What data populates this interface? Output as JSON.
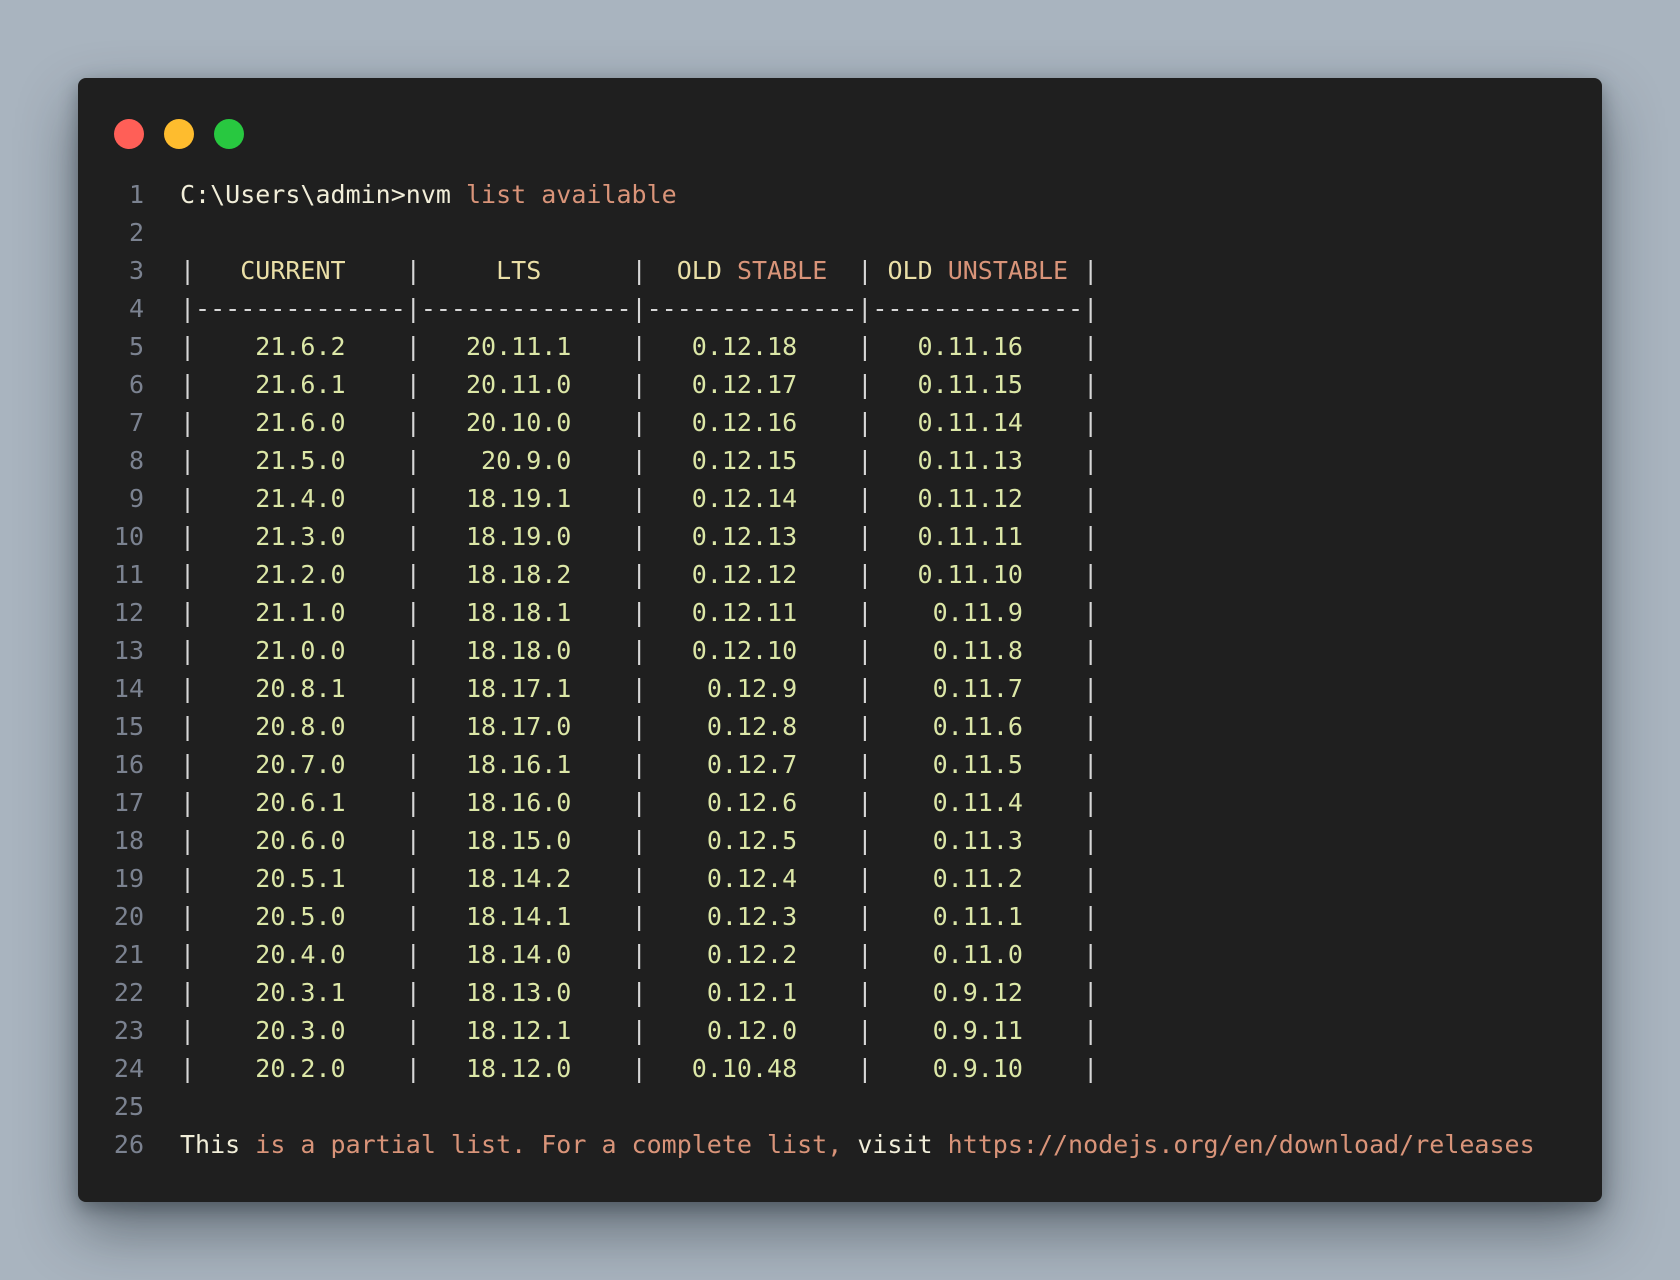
{
  "window": {
    "dots": [
      {
        "name": "close-dot",
        "color": "#ff5f57"
      },
      {
        "name": "minimize-dot",
        "color": "#febc2e"
      },
      {
        "name": "maximize-dot",
        "color": "#28c840"
      }
    ]
  },
  "colors": {
    "background": "#a9b4bf",
    "panel": "#1f1f1f",
    "line_number": "#7b8290",
    "plain_text": "#f1eed9",
    "string_text": "#d99479",
    "header_text": "#eadfa7",
    "version_text": "#dce7a7",
    "bar_text": "#d7d7d7"
  },
  "lines": [
    {
      "number": "1",
      "segments": [
        {
          "text": "C:\\Users\\admin>nvm ",
          "kind": "plain"
        },
        {
          "text": "list available",
          "kind": "str"
        }
      ]
    },
    {
      "number": "2",
      "segments": []
    },
    {
      "number": "3",
      "segments": [
        {
          "text": "|",
          "kind": "bar"
        },
        {
          "text": "   CURRENT    ",
          "kind": "head"
        },
        {
          "text": "|",
          "kind": "bar"
        },
        {
          "text": "     LTS      ",
          "kind": "head"
        },
        {
          "text": "|",
          "kind": "bar"
        },
        {
          "text": "  OLD ",
          "kind": "head"
        },
        {
          "text": "STABLE",
          "kind": "str"
        },
        {
          "text": "  ",
          "kind": "head"
        },
        {
          "text": "|",
          "kind": "bar"
        },
        {
          "text": " OLD ",
          "kind": "head"
        },
        {
          "text": "UNSTABLE",
          "kind": "str"
        },
        {
          "text": " ",
          "kind": "head"
        },
        {
          "text": "|",
          "kind": "bar"
        }
      ]
    },
    {
      "number": "4",
      "segments": [
        {
          "text": "|--------------|--------------|--------------|--------------|",
          "kind": "bar"
        }
      ]
    },
    {
      "number": "5",
      "segments": [
        {
          "text": "|",
          "kind": "bar"
        },
        {
          "text": "    21.6.2    ",
          "kind": "num"
        },
        {
          "text": "|",
          "kind": "bar"
        },
        {
          "text": "   20.11.1    ",
          "kind": "num"
        },
        {
          "text": "|",
          "kind": "bar"
        },
        {
          "text": "   0.12.18    ",
          "kind": "num"
        },
        {
          "text": "|",
          "kind": "bar"
        },
        {
          "text": "   0.11.16    ",
          "kind": "num"
        },
        {
          "text": "|",
          "kind": "bar"
        }
      ]
    },
    {
      "number": "6",
      "segments": [
        {
          "text": "|",
          "kind": "bar"
        },
        {
          "text": "    21.6.1    ",
          "kind": "num"
        },
        {
          "text": "|",
          "kind": "bar"
        },
        {
          "text": "   20.11.0    ",
          "kind": "num"
        },
        {
          "text": "|",
          "kind": "bar"
        },
        {
          "text": "   0.12.17    ",
          "kind": "num"
        },
        {
          "text": "|",
          "kind": "bar"
        },
        {
          "text": "   0.11.15    ",
          "kind": "num"
        },
        {
          "text": "|",
          "kind": "bar"
        }
      ]
    },
    {
      "number": "7",
      "segments": [
        {
          "text": "|",
          "kind": "bar"
        },
        {
          "text": "    21.6.0    ",
          "kind": "num"
        },
        {
          "text": "|",
          "kind": "bar"
        },
        {
          "text": "   20.10.0    ",
          "kind": "num"
        },
        {
          "text": "|",
          "kind": "bar"
        },
        {
          "text": "   0.12.16    ",
          "kind": "num"
        },
        {
          "text": "|",
          "kind": "bar"
        },
        {
          "text": "   0.11.14    ",
          "kind": "num"
        },
        {
          "text": "|",
          "kind": "bar"
        }
      ]
    },
    {
      "number": "8",
      "segments": [
        {
          "text": "|",
          "kind": "bar"
        },
        {
          "text": "    21.5.0    ",
          "kind": "num"
        },
        {
          "text": "|",
          "kind": "bar"
        },
        {
          "text": "    20.9.0    ",
          "kind": "num"
        },
        {
          "text": "|",
          "kind": "bar"
        },
        {
          "text": "   0.12.15    ",
          "kind": "num"
        },
        {
          "text": "|",
          "kind": "bar"
        },
        {
          "text": "   0.11.13    ",
          "kind": "num"
        },
        {
          "text": "|",
          "kind": "bar"
        }
      ]
    },
    {
      "number": "9",
      "segments": [
        {
          "text": "|",
          "kind": "bar"
        },
        {
          "text": "    21.4.0    ",
          "kind": "num"
        },
        {
          "text": "|",
          "kind": "bar"
        },
        {
          "text": "   18.19.1    ",
          "kind": "num"
        },
        {
          "text": "|",
          "kind": "bar"
        },
        {
          "text": "   0.12.14    ",
          "kind": "num"
        },
        {
          "text": "|",
          "kind": "bar"
        },
        {
          "text": "   0.11.12    ",
          "kind": "num"
        },
        {
          "text": "|",
          "kind": "bar"
        }
      ]
    },
    {
      "number": "10",
      "segments": [
        {
          "text": "|",
          "kind": "bar"
        },
        {
          "text": "    21.3.0    ",
          "kind": "num"
        },
        {
          "text": "|",
          "kind": "bar"
        },
        {
          "text": "   18.19.0    ",
          "kind": "num"
        },
        {
          "text": "|",
          "kind": "bar"
        },
        {
          "text": "   0.12.13    ",
          "kind": "num"
        },
        {
          "text": "|",
          "kind": "bar"
        },
        {
          "text": "   0.11.11    ",
          "kind": "num"
        },
        {
          "text": "|",
          "kind": "bar"
        }
      ]
    },
    {
      "number": "11",
      "segments": [
        {
          "text": "|",
          "kind": "bar"
        },
        {
          "text": "    21.2.0    ",
          "kind": "num"
        },
        {
          "text": "|",
          "kind": "bar"
        },
        {
          "text": "   18.18.2    ",
          "kind": "num"
        },
        {
          "text": "|",
          "kind": "bar"
        },
        {
          "text": "   0.12.12    ",
          "kind": "num"
        },
        {
          "text": "|",
          "kind": "bar"
        },
        {
          "text": "   0.11.10    ",
          "kind": "num"
        },
        {
          "text": "|",
          "kind": "bar"
        }
      ]
    },
    {
      "number": "12",
      "segments": [
        {
          "text": "|",
          "kind": "bar"
        },
        {
          "text": "    21.1.0    ",
          "kind": "num"
        },
        {
          "text": "|",
          "kind": "bar"
        },
        {
          "text": "   18.18.1    ",
          "kind": "num"
        },
        {
          "text": "|",
          "kind": "bar"
        },
        {
          "text": "   0.12.11    ",
          "kind": "num"
        },
        {
          "text": "|",
          "kind": "bar"
        },
        {
          "text": "    0.11.9    ",
          "kind": "num"
        },
        {
          "text": "|",
          "kind": "bar"
        }
      ]
    },
    {
      "number": "13",
      "segments": [
        {
          "text": "|",
          "kind": "bar"
        },
        {
          "text": "    21.0.0    ",
          "kind": "num"
        },
        {
          "text": "|",
          "kind": "bar"
        },
        {
          "text": "   18.18.0    ",
          "kind": "num"
        },
        {
          "text": "|",
          "kind": "bar"
        },
        {
          "text": "   0.12.10    ",
          "kind": "num"
        },
        {
          "text": "|",
          "kind": "bar"
        },
        {
          "text": "    0.11.8    ",
          "kind": "num"
        },
        {
          "text": "|",
          "kind": "bar"
        }
      ]
    },
    {
      "number": "14",
      "segments": [
        {
          "text": "|",
          "kind": "bar"
        },
        {
          "text": "    20.8.1    ",
          "kind": "num"
        },
        {
          "text": "|",
          "kind": "bar"
        },
        {
          "text": "   18.17.1    ",
          "kind": "num"
        },
        {
          "text": "|",
          "kind": "bar"
        },
        {
          "text": "    0.12.9    ",
          "kind": "num"
        },
        {
          "text": "|",
          "kind": "bar"
        },
        {
          "text": "    0.11.7    ",
          "kind": "num"
        },
        {
          "text": "|",
          "kind": "bar"
        }
      ]
    },
    {
      "number": "15",
      "segments": [
        {
          "text": "|",
          "kind": "bar"
        },
        {
          "text": "    20.8.0    ",
          "kind": "num"
        },
        {
          "text": "|",
          "kind": "bar"
        },
        {
          "text": "   18.17.0    ",
          "kind": "num"
        },
        {
          "text": "|",
          "kind": "bar"
        },
        {
          "text": "    0.12.8    ",
          "kind": "num"
        },
        {
          "text": "|",
          "kind": "bar"
        },
        {
          "text": "    0.11.6    ",
          "kind": "num"
        },
        {
          "text": "|",
          "kind": "bar"
        }
      ]
    },
    {
      "number": "16",
      "segments": [
        {
          "text": "|",
          "kind": "bar"
        },
        {
          "text": "    20.7.0    ",
          "kind": "num"
        },
        {
          "text": "|",
          "kind": "bar"
        },
        {
          "text": "   18.16.1    ",
          "kind": "num"
        },
        {
          "text": "|",
          "kind": "bar"
        },
        {
          "text": "    0.12.7    ",
          "kind": "num"
        },
        {
          "text": "|",
          "kind": "bar"
        },
        {
          "text": "    0.11.5    ",
          "kind": "num"
        },
        {
          "text": "|",
          "kind": "bar"
        }
      ]
    },
    {
      "number": "17",
      "segments": [
        {
          "text": "|",
          "kind": "bar"
        },
        {
          "text": "    20.6.1    ",
          "kind": "num"
        },
        {
          "text": "|",
          "kind": "bar"
        },
        {
          "text": "   18.16.0    ",
          "kind": "num"
        },
        {
          "text": "|",
          "kind": "bar"
        },
        {
          "text": "    0.12.6    ",
          "kind": "num"
        },
        {
          "text": "|",
          "kind": "bar"
        },
        {
          "text": "    0.11.4    ",
          "kind": "num"
        },
        {
          "text": "|",
          "kind": "bar"
        }
      ]
    },
    {
      "number": "18",
      "segments": [
        {
          "text": "|",
          "kind": "bar"
        },
        {
          "text": "    20.6.0    ",
          "kind": "num"
        },
        {
          "text": "|",
          "kind": "bar"
        },
        {
          "text": "   18.15.0    ",
          "kind": "num"
        },
        {
          "text": "|",
          "kind": "bar"
        },
        {
          "text": "    0.12.5    ",
          "kind": "num"
        },
        {
          "text": "|",
          "kind": "bar"
        },
        {
          "text": "    0.11.3    ",
          "kind": "num"
        },
        {
          "text": "|",
          "kind": "bar"
        }
      ]
    },
    {
      "number": "19",
      "segments": [
        {
          "text": "|",
          "kind": "bar"
        },
        {
          "text": "    20.5.1    ",
          "kind": "num"
        },
        {
          "text": "|",
          "kind": "bar"
        },
        {
          "text": "   18.14.2    ",
          "kind": "num"
        },
        {
          "text": "|",
          "kind": "bar"
        },
        {
          "text": "    0.12.4    ",
          "kind": "num"
        },
        {
          "text": "|",
          "kind": "bar"
        },
        {
          "text": "    0.11.2    ",
          "kind": "num"
        },
        {
          "text": "|",
          "kind": "bar"
        }
      ]
    },
    {
      "number": "20",
      "segments": [
        {
          "text": "|",
          "kind": "bar"
        },
        {
          "text": "    20.5.0    ",
          "kind": "num"
        },
        {
          "text": "|",
          "kind": "bar"
        },
        {
          "text": "   18.14.1    ",
          "kind": "num"
        },
        {
          "text": "|",
          "kind": "bar"
        },
        {
          "text": "    0.12.3    ",
          "kind": "num"
        },
        {
          "text": "|",
          "kind": "bar"
        },
        {
          "text": "    0.11.1    ",
          "kind": "num"
        },
        {
          "text": "|",
          "kind": "bar"
        }
      ]
    },
    {
      "number": "21",
      "segments": [
        {
          "text": "|",
          "kind": "bar"
        },
        {
          "text": "    20.4.0    ",
          "kind": "num"
        },
        {
          "text": "|",
          "kind": "bar"
        },
        {
          "text": "   18.14.0    ",
          "kind": "num"
        },
        {
          "text": "|",
          "kind": "bar"
        },
        {
          "text": "    0.12.2    ",
          "kind": "num"
        },
        {
          "text": "|",
          "kind": "bar"
        },
        {
          "text": "    0.11.0    ",
          "kind": "num"
        },
        {
          "text": "|",
          "kind": "bar"
        }
      ]
    },
    {
      "number": "22",
      "segments": [
        {
          "text": "|",
          "kind": "bar"
        },
        {
          "text": "    20.3.1    ",
          "kind": "num"
        },
        {
          "text": "|",
          "kind": "bar"
        },
        {
          "text": "   18.13.0    ",
          "kind": "num"
        },
        {
          "text": "|",
          "kind": "bar"
        },
        {
          "text": "    0.12.1    ",
          "kind": "num"
        },
        {
          "text": "|",
          "kind": "bar"
        },
        {
          "text": "    0.9.12    ",
          "kind": "num"
        },
        {
          "text": "|",
          "kind": "bar"
        }
      ]
    },
    {
      "number": "23",
      "segments": [
        {
          "text": "|",
          "kind": "bar"
        },
        {
          "text": "    20.3.0    ",
          "kind": "num"
        },
        {
          "text": "|",
          "kind": "bar"
        },
        {
          "text": "   18.12.1    ",
          "kind": "num"
        },
        {
          "text": "|",
          "kind": "bar"
        },
        {
          "text": "    0.12.0    ",
          "kind": "num"
        },
        {
          "text": "|",
          "kind": "bar"
        },
        {
          "text": "    0.9.11    ",
          "kind": "num"
        },
        {
          "text": "|",
          "kind": "bar"
        }
      ]
    },
    {
      "number": "24",
      "segments": [
        {
          "text": "|",
          "kind": "bar"
        },
        {
          "text": "    20.2.0    ",
          "kind": "num"
        },
        {
          "text": "|",
          "kind": "bar"
        },
        {
          "text": "   18.12.0    ",
          "kind": "num"
        },
        {
          "text": "|",
          "kind": "bar"
        },
        {
          "text": "   0.10.48    ",
          "kind": "num"
        },
        {
          "text": "|",
          "kind": "bar"
        },
        {
          "text": "    0.9.10    ",
          "kind": "num"
        },
        {
          "text": "|",
          "kind": "bar"
        }
      ]
    },
    {
      "number": "25",
      "segments": []
    },
    {
      "number": "26",
      "segments": [
        {
          "text": "This ",
          "kind": "plain"
        },
        {
          "text": "is a partial list. For a complete list, ",
          "kind": "str"
        },
        {
          "text": "visit ",
          "kind": "plain"
        },
        {
          "text": "https://nodejs.org/en/download/releases",
          "kind": "str"
        }
      ]
    }
  ]
}
